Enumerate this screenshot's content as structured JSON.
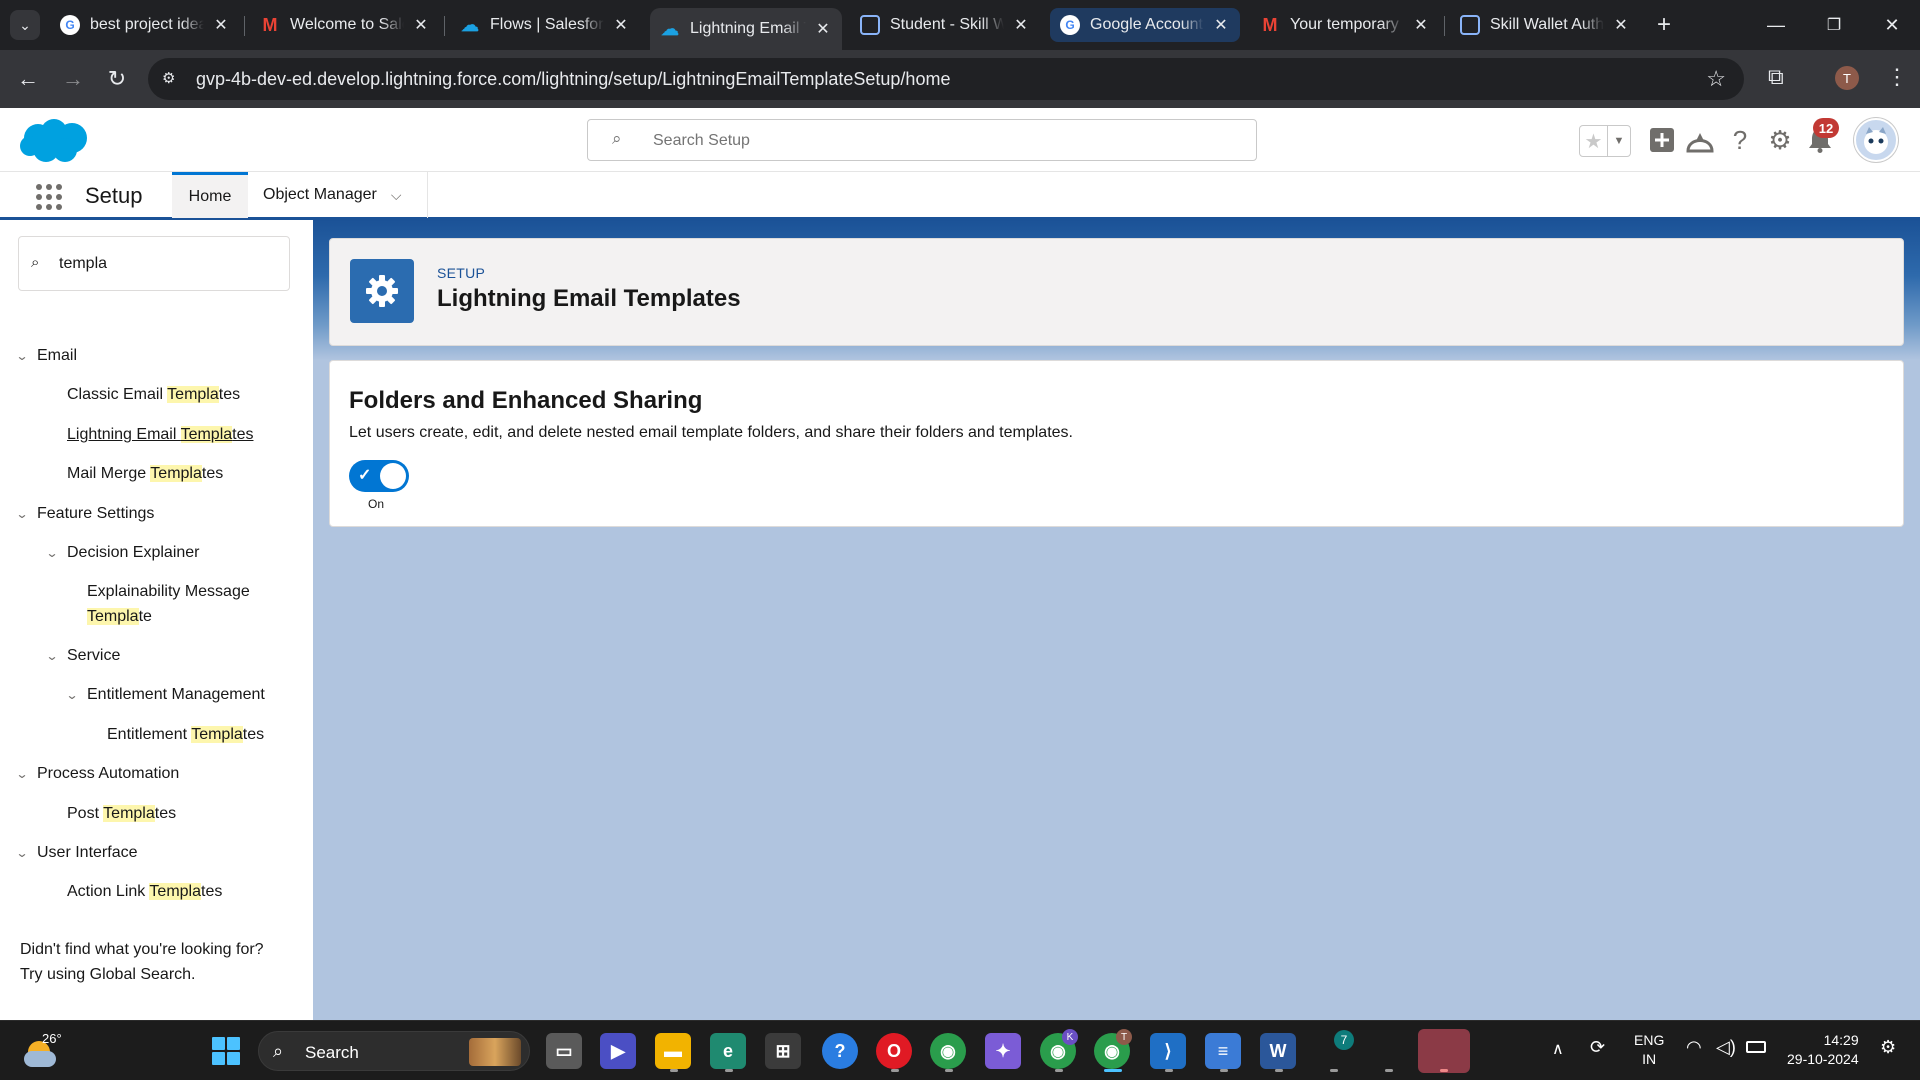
{
  "browser": {
    "tabs": [
      {
        "title": "best project idea",
        "favicon": "google-icon"
      },
      {
        "title": "Welcome to Sale",
        "favicon": "gmail-icon"
      },
      {
        "title": "Flows | Salesforc",
        "favicon": "salesforce-icon"
      },
      {
        "title": "Lightning Email T",
        "favicon": "salesforce-icon",
        "active": true
      },
      {
        "title": "Student - Skill W",
        "favicon": "page-icon"
      },
      {
        "title": "Google Account",
        "favicon": "google-icon"
      },
      {
        "title": "Your temporary p",
        "favicon": "gmail-icon"
      },
      {
        "title": "Skill Wallet Auth",
        "favicon": "page-icon"
      }
    ],
    "url": "gvp-4b-dev-ed.develop.lightning.force.com/lightning/setup/LightningEmailTemplateSetup/home",
    "profile_initial": "T"
  },
  "header": {
    "search_placeholder": "Search Setup",
    "notification_count": "12"
  },
  "nav": {
    "app_name": "Setup",
    "home": "Home",
    "object_manager": "Object Manager"
  },
  "sidebar": {
    "quick_find_value": "templa",
    "footer_line1": "Didn't find what you're looking for?",
    "footer_line2": "Try using Global Search."
  },
  "tree": [
    {
      "pre": "Email",
      "hl": "",
      "post": "",
      "expanded": true
    },
    {
      "pre": "Classic Email ",
      "hl": "Templa",
      "post": "tes"
    },
    {
      "pre": "Lightning Email ",
      "hl": "Templa",
      "post": "tes",
      "current": true
    },
    {
      "pre": "Mail Merge ",
      "hl": "Templa",
      "post": "tes"
    },
    {
      "pre": "Feature Settings",
      "hl": "",
      "post": "",
      "expanded": true
    },
    {
      "pre": "Decision Explainer",
      "hl": "",
      "post": "",
      "expanded": true
    },
    {
      "pre": "Explainability Message",
      "hl": "",
      "post": ""
    },
    {
      "pre": "",
      "hl": "Templa",
      "post": "te"
    },
    {
      "pre": "Service",
      "hl": "",
      "post": "",
      "expanded": true
    },
    {
      "pre": "Entitlement Management",
      "hl": "",
      "post": "",
      "expanded": true
    },
    {
      "pre": "Entitlement ",
      "hl": "Templa",
      "post": "tes"
    },
    {
      "pre": "Process Automation",
      "hl": "",
      "post": "",
      "expanded": true
    },
    {
      "pre": "Post ",
      "hl": "Templa",
      "post": "tes"
    },
    {
      "pre": "User Interface",
      "hl": "",
      "post": "",
      "expanded": true
    },
    {
      "pre": "Action Link ",
      "hl": "Templa",
      "post": "tes"
    }
  ],
  "page": {
    "eyebrow": "SETUP",
    "title": "Lightning Email Templates"
  },
  "card": {
    "title": "Folders and Enhanced Sharing",
    "description": "Let users create, edit, and delete nested email template folders, and share their folders and templates.",
    "toggle_state": "On"
  },
  "taskbar": {
    "temperature": "26°",
    "search_label": "Search",
    "lang_line1": "ENG",
    "lang_line2": "IN",
    "time": "14:29",
    "date": "29-10-2024",
    "chrome_badge_1": "K",
    "chrome_badge_2": "T",
    "app_badge": "7"
  },
  "colors": {
    "salesforce_blue": "#0176d3",
    "highlight": "#fdf6ad",
    "main_bg": "#b0c4df"
  }
}
